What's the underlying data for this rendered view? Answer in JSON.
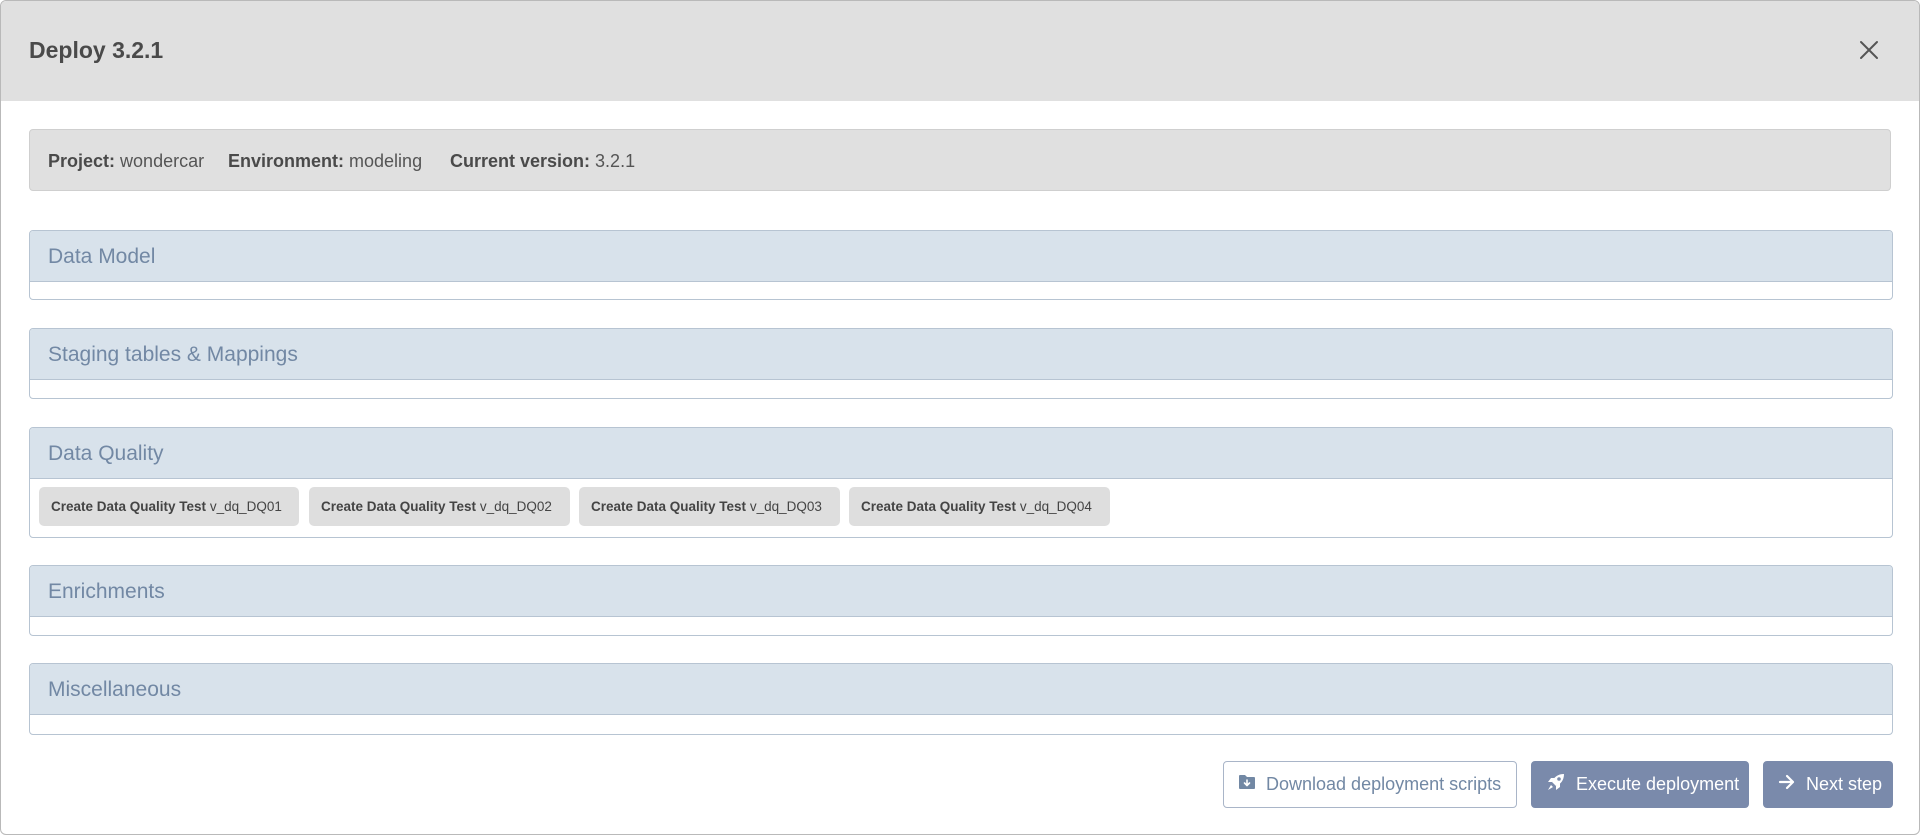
{
  "modal": {
    "title": "Deploy 3.2.1",
    "close_icon": "close-icon"
  },
  "info": {
    "project_label": "Project:",
    "project_value": "wondercar",
    "environment_label": "Environment:",
    "environment_value": "modeling",
    "version_label": "Current version:",
    "version_value": "3.2.1"
  },
  "sections": [
    {
      "title": "Data Model",
      "items": []
    },
    {
      "title": "Staging tables & Mappings",
      "items": []
    },
    {
      "title": "Data Quality",
      "items": [
        {
          "action": "Create Data Quality Test",
          "name": "v_dq_DQ01"
        },
        {
          "action": "Create Data Quality Test",
          "name": "v_dq_DQ02"
        },
        {
          "action": "Create Data Quality Test",
          "name": "v_dq_DQ03"
        },
        {
          "action": "Create Data Quality Test",
          "name": "v_dq_DQ04"
        }
      ]
    },
    {
      "title": "Enrichments",
      "items": []
    },
    {
      "title": "Miscellaneous",
      "items": []
    }
  ],
  "footer": {
    "download_label": "Download deployment scripts",
    "download_icon": "folder-download-icon",
    "execute_label": "Execute deployment",
    "execute_icon": "rocket-icon",
    "next_label": "Next step",
    "next_icon": "arrow-right-icon"
  },
  "colors": {
    "header_bg": "#e0e0e0",
    "section_header_bg": "#d8e2eb",
    "section_title": "#7288a4",
    "primary_button": "#7a8aab"
  }
}
